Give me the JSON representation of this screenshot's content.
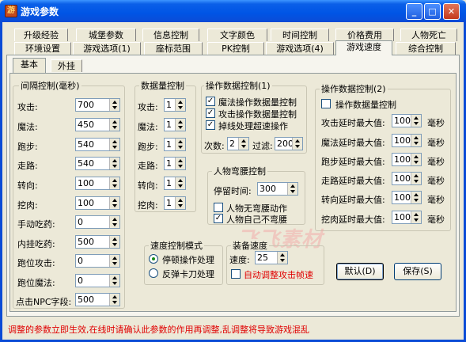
{
  "window": {
    "title": "游戏参数",
    "icon": "game-icon",
    "controls": [
      "minimize",
      "maximize",
      "close"
    ]
  },
  "tabs_row1": [
    "升级经验",
    "城堡参数",
    "信息控制",
    "文字颜色",
    "时间控制",
    "价格费用",
    "人物死亡"
  ],
  "tabs_row2": [
    "环境设置",
    "游戏选项(1)",
    "座标范围",
    "PK控制",
    "游戏选项(4)",
    "游戏速度",
    "综合控制"
  ],
  "active_tab": "游戏速度",
  "subtabs": [
    "基本",
    "外挂"
  ],
  "interval_group": {
    "title": "间隔控制(毫秒)",
    "rows": [
      {
        "label": "攻击:",
        "value": "700"
      },
      {
        "label": "魔法:",
        "value": "450"
      },
      {
        "label": "跑步:",
        "value": "540"
      },
      {
        "label": "走路:",
        "value": "540"
      },
      {
        "label": "转向:",
        "value": "100"
      },
      {
        "label": "挖肉:",
        "value": "100"
      },
      {
        "label": "手动吃药:",
        "value": "0"
      },
      {
        "label": "内挂吃药:",
        "value": "500"
      },
      {
        "label": "跑位攻击:",
        "value": "0"
      },
      {
        "label": "跑位魔法:",
        "value": "0"
      },
      {
        "label": "点击NPC字段:",
        "value": "500"
      }
    ]
  },
  "count_group": {
    "title": "数据量控制",
    "rows": [
      {
        "label": "攻击:",
        "value": "1"
      },
      {
        "label": "魔法:",
        "value": "1"
      },
      {
        "label": "跑步:",
        "value": "1"
      },
      {
        "label": "走路:",
        "value": "1"
      },
      {
        "label": "转向:",
        "value": "1"
      },
      {
        "label": "挖肉:",
        "value": "1"
      }
    ]
  },
  "op_group1": {
    "title": "操作数据控制(1)",
    "checks": [
      {
        "label": "魔法操作数据量控制",
        "checked": true
      },
      {
        "label": "攻击操作数据量控制",
        "checked": true
      },
      {
        "label": "掉线处理超速操作",
        "checked": true
      }
    ],
    "times_label": "次数:",
    "times_value": "2",
    "filter_label": "过滤:",
    "filter_value": "200"
  },
  "stoop_group": {
    "title": "人物弯腰控制",
    "stay_label": "停留时间:",
    "stay_value": "300",
    "checks": [
      {
        "label": "人物无弯腰动作",
        "checked": false
      },
      {
        "label": "人物自己不弯腰",
        "checked": true
      }
    ]
  },
  "op_group2": {
    "title": "操作数据控制(2)",
    "check": {
      "label": "操作数据量控制",
      "checked": false
    },
    "rows": [
      {
        "label": "攻击延时最大值:",
        "value": "100",
        "unit": "毫秒"
      },
      {
        "label": "魔法延时最大值:",
        "value": "100",
        "unit": "毫秒"
      },
      {
        "label": "跑步延时最大值:",
        "value": "100",
        "unit": "毫秒"
      },
      {
        "label": "走路延时最大值:",
        "value": "100",
        "unit": "毫秒"
      },
      {
        "label": "转向延时最大值:",
        "value": "100",
        "unit": "毫秒"
      },
      {
        "label": "挖肉延时最大值:",
        "value": "100",
        "unit": "毫秒"
      }
    ]
  },
  "speed_mode": {
    "title": "速度控制模式",
    "options": [
      {
        "label": "停顿操作处理",
        "selected": true
      },
      {
        "label": "反弹卡刀处理",
        "selected": false
      }
    ]
  },
  "equip_speed": {
    "title": "装备速度",
    "speed_label": "速度:",
    "speed_value": "25",
    "auto_label": "自动调整攻击帧速",
    "auto_checked": false
  },
  "buttons": {
    "default": "默认(D)",
    "save": "保存(S)"
  },
  "watermark": "飞飞素材",
  "status_text": "调整的参数立即生效,在线时请确认此参数的作用再调整,乱调整将导致游戏混乱",
  "colors": {
    "titlebar": "#0055e5",
    "status": "#e00000",
    "window_bg": "#ece9d8"
  }
}
